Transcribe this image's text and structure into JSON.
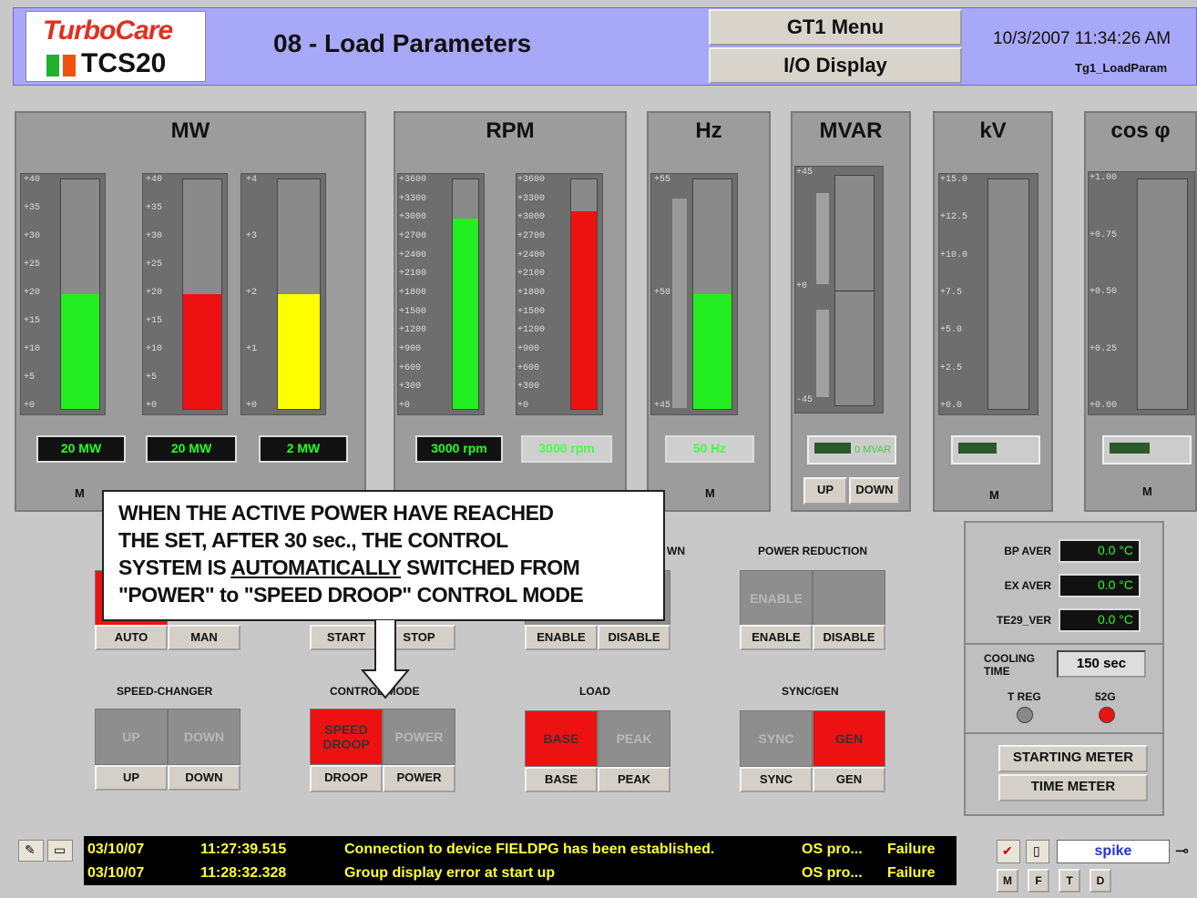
{
  "header": {
    "logo_line1": "TurboCare",
    "logo_line2": "TCS20",
    "title": "08 - Load Parameters",
    "menu_button": "GT1 Menu",
    "io_button": "I/O Display",
    "datetime": "10/3/2007 11:34:26 AM",
    "screen_id": "Tg1_LoadParam"
  },
  "colors": {
    "green": "#22ee22",
    "red": "#ee1111",
    "yellow": "#ffff00",
    "alarm_text": "#ffff33"
  },
  "panels": {
    "mw": {
      "title": "MW",
      "marker": "M",
      "gauges": [
        {
          "scale": [
            "+40",
            "+35",
            "+30",
            "+25",
            "+20",
            "+15",
            "+10",
            "+5",
            "+0"
          ],
          "level": 0.5,
          "color": "green",
          "readout": "20 MW"
        },
        {
          "scale": [
            "+40",
            "+35",
            "+30",
            "+25",
            "+20",
            "+15",
            "+10",
            "+5",
            "+0"
          ],
          "level": 0.5,
          "color": "red",
          "readout": "20 MW"
        },
        {
          "scale": [
            "+4",
            "+3",
            "+2",
            "+1",
            "+0"
          ],
          "level": 0.5,
          "color": "yellow",
          "readout": "2 MW"
        }
      ]
    },
    "rpm": {
      "title": "RPM",
      "gauges": [
        {
          "scale": [
            "+3600",
            "+3300",
            "+3000",
            "+2700",
            "+2400",
            "+2100",
            "+1800",
            "+1500",
            "+1200",
            "+900",
            "+600",
            "+300",
            "+0"
          ],
          "level": 0.83,
          "color": "green",
          "readout": "3000 rpm"
        },
        {
          "scale": [
            "+3600",
            "+3300",
            "+3000",
            "+2700",
            "+2400",
            "+2100",
            "+1800",
            "+1500",
            "+1200",
            "+900",
            "+600",
            "+300",
            "+0"
          ],
          "level": 0.86,
          "color": "red",
          "readout": "3000 rpm"
        }
      ]
    },
    "hz": {
      "title": "Hz",
      "marker": "M",
      "scale": [
        "+55",
        "+50",
        "+45"
      ],
      "level": 0.5,
      "readout": "50 Hz"
    },
    "mvar": {
      "title": "MVAR",
      "scale": [
        "+45",
        "+0",
        "-45"
      ],
      "bar_value": "0 MVAR",
      "up": "UP",
      "down": "DOWN"
    },
    "kv": {
      "title": "kV",
      "marker": "M",
      "scale": [
        "+15.0",
        "+12.5",
        "+10.0",
        "+7.5",
        "+5.0",
        "+2.5",
        "+0.0"
      ]
    },
    "cos": {
      "title": "cos φ",
      "marker": "M",
      "scale": [
        "+1.00",
        "+0.75",
        "+0.50",
        "+0.25",
        "+0.00"
      ]
    }
  },
  "callout": {
    "line1": "WHEN THE ACTIVE POWER HAVE REACHED",
    "line2": "THE SET, AFTER 30 sec., THE CONTROL",
    "line3_pre": "SYSTEM IS ",
    "line3_underlined": "AUTOMATICALLY",
    "line3_post": " SWITCHED FROM",
    "line4": "\"POWER\" to \"SPEED DROOP\" CONTROL MODE"
  },
  "controls": {
    "mode": {
      "auto": "AUTO",
      "man": "MAN"
    },
    "start_stop": {
      "start": "START",
      "stop": "STOP"
    },
    "partial_title": "WN",
    "enable_group": {
      "enable": "ENABLE",
      "disable": "DISABLE"
    },
    "power_reduction": {
      "title": "POWER REDUCTION",
      "indicator": "ENABLE",
      "enable": "ENABLE",
      "disable": "DISABLE"
    },
    "speed_changer": {
      "title": "SPEED-CHANGER",
      "ind_up": "UP",
      "ind_down": "DOWN",
      "up": "UP",
      "down": "DOWN"
    },
    "control_mode": {
      "title": "CONTROL MODE",
      "ind_droop": "SPEED DROOP",
      "ind_power": "POWER",
      "droop": "DROOP",
      "power": "POWER"
    },
    "load": {
      "title": "LOAD",
      "ind_base": "BASE",
      "ind_peak": "PEAK",
      "base": "BASE",
      "peak": "PEAK"
    },
    "sync_gen": {
      "title": "SYNC/GEN",
      "ind_sync": "SYNC",
      "ind_gen": "GEN",
      "sync": "SYNC",
      "gen": "GEN"
    }
  },
  "temperatures": {
    "bp_label": "BP AVER",
    "bp_value": "0.0 °C",
    "ex_label": "EX AVER",
    "ex_value": "0.0 °C",
    "te_label": "TE29_VER",
    "te_value": "0.0 °C",
    "cooling_label1": "COOLING",
    "cooling_label2": "TIME",
    "cooling_value": "150 sec",
    "treg_label": "T REG",
    "g52_label": "52G",
    "starting_meter": "STARTING METER",
    "time_meter": "TIME METER"
  },
  "alarms": [
    {
      "date": "03/10/07",
      "time": "11:27:39.515",
      "message": "Connection to device FIELDPG has been established.",
      "source": "OS pro...",
      "status": "Failure"
    },
    {
      "date": "03/10/07",
      "time": "11:28:32.328",
      "message": "Group display error at start up",
      "source": "OS pro...",
      "status": "Failure"
    }
  ],
  "footer": {
    "user": "spike",
    "m": "M",
    "f": "F",
    "t": "T",
    "d": "D"
  }
}
